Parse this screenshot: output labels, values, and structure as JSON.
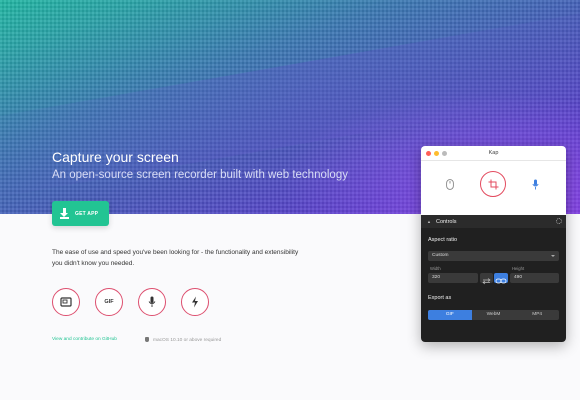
{
  "hero": {
    "title": "Capture your screen",
    "subtitle": "An open-source screen recorder built with web technology",
    "cta_label": "GET APP"
  },
  "intro": {
    "description": "The ease of use and speed you've been looking for - the functionality and extensibility you didn't know you needed."
  },
  "features": [
    {
      "icon": "screen-icon"
    },
    {
      "icon": "gif-icon",
      "label": "GIF"
    },
    {
      "icon": "microphone-icon"
    },
    {
      "icon": "lightning-icon"
    }
  ],
  "footer": {
    "link_text": "View and contribute on GitHub",
    "requirement": "macOS 10.10 or above required"
  },
  "kap_window": {
    "title": "Kap",
    "tools": [
      "mouse-icon",
      "crop-icon",
      "microphone-icon"
    ],
    "controls_label": "Controls",
    "aspect_ratio_label": "Aspect ratio",
    "aspect_ratio_value": "Custom",
    "width_label": "Width",
    "width_value": "320",
    "height_label": "Height",
    "height_value": "490",
    "export_label": "Export as",
    "formats": [
      "GIF",
      "WebM",
      "MP4"
    ],
    "selected_format": "GIF"
  },
  "colors": {
    "accent_green": "#22c493",
    "feature_ring": "#dd4f6f",
    "crop_ring": "#e34b5f",
    "format_active": "#3d7fe0",
    "window_dark": "#202020"
  }
}
